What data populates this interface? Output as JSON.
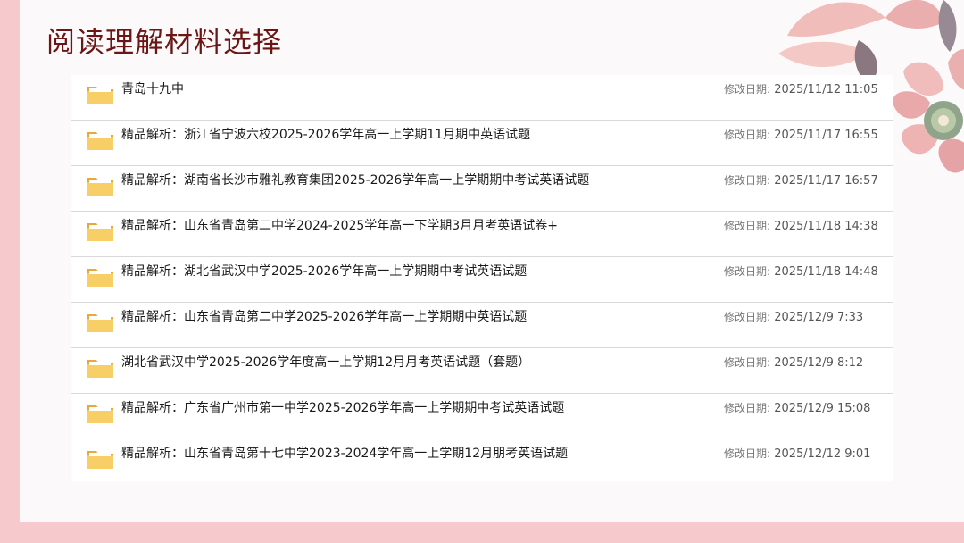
{
  "title": "阅读理解材料选择",
  "date_label": "修改日期:",
  "files": [
    {
      "name": "青岛十九中",
      "date": "2025/11/12 11:05"
    },
    {
      "name": "精品解析：浙江省宁波六校2025-2026学年高一上学期11月期中英语试题",
      "date": "2025/11/17 16:55"
    },
    {
      "name": "精品解析：湖南省长沙市雅礼教育集团2025-2026学年高一上学期期中考试英语试题",
      "date": "2025/11/17 16:57"
    },
    {
      "name": "精品解析：山东省青岛第二中学2024-2025学年高一下学期3月月考英语试卷+",
      "date": "2025/11/18 14:38"
    },
    {
      "name": "精品解析：湖北省武汉中学2025-2026学年高一上学期期中考试英语试题",
      "date": "2025/11/18 14:48"
    },
    {
      "name": "精品解析：山东省青岛第二中学2025-2026学年高一上学期期中英语试题",
      "date": "2025/12/9 7:33"
    },
    {
      "name": "湖北省武汉中学2025-2026学年度高一上学期12月月考英语试题（套题）",
      "date": "2025/12/9 8:12"
    },
    {
      "name": "精品解析：广东省广州市第一中学2025-2026学年高一上学期期中考试英语试题",
      "date": "2025/12/9 15:08"
    },
    {
      "name": "精品解析：山东省青岛第十七中学2023-2024学年高一上学期12月朋考英语试题",
      "date": "2025/12/12 9:01"
    }
  ],
  "colors": {
    "background": "#f6c9cd",
    "title": "#6b1515",
    "folder": "#f6c451"
  },
  "icons": {
    "file": "folder-icon",
    "decoration": "flower-decoration"
  }
}
